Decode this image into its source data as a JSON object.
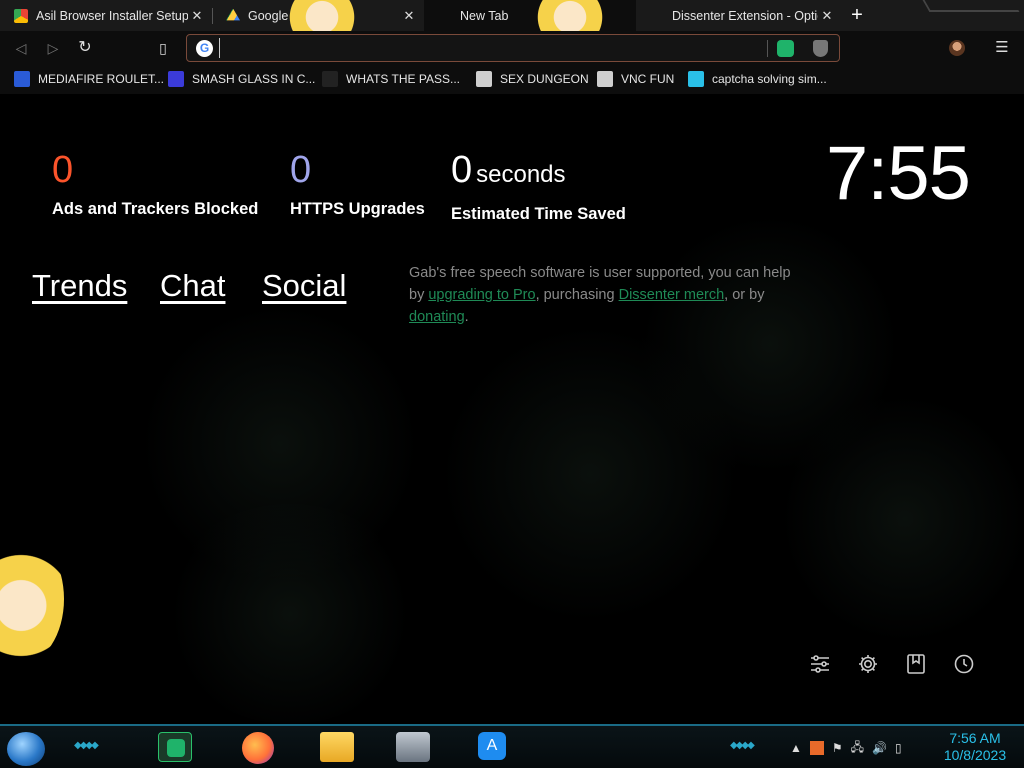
{
  "tabs": [
    {
      "title": "Asil Browser Installer Setup.exe",
      "favicon": "chrome-webstore-icon",
      "active": false
    },
    {
      "title": "Google Drive",
      "favicon": "google-drive-icon",
      "active": false
    },
    {
      "title": "New Tab",
      "favicon": "",
      "active": true
    },
    {
      "title": "Dissenter Extension - Options",
      "favicon": "",
      "active": false
    }
  ],
  "toolbar": {
    "address_value": "",
    "icons": {
      "back": "back-icon",
      "forward": "forward-icon",
      "reload": "reload-icon",
      "bookmark": "bookmark-icon",
      "menu": "menu-icon"
    }
  },
  "bookmarks": [
    {
      "label": "MEDIAFIRE ROULET...",
      "color": "#2a5bd7"
    },
    {
      "label": "SMASH GLASS IN C...",
      "color": "#3b3bd9"
    },
    {
      "label": "WHATS THE PASS...",
      "color": "#222222"
    },
    {
      "label": "SEX DUNGEON",
      "color": "#cfcfcf"
    },
    {
      "label": "VNC FUN",
      "color": "#cfcfcf"
    },
    {
      "label": "captcha solving sim...",
      "color": "#2ac0e8"
    }
  ],
  "stats": {
    "ads": {
      "value": "0",
      "label": "Ads and Trackers Blocked",
      "color": "#fb542b"
    },
    "https": {
      "value": "0",
      "label": "HTTPS Upgrades",
      "color": "#a0a5eb"
    },
    "time": {
      "value": "0",
      "unit": "seconds",
      "label": "Estimated Time Saved"
    }
  },
  "clock": "7:55",
  "links": {
    "trends": "Trends",
    "chat": "Chat",
    "social": "Social"
  },
  "promo": {
    "text1": "Gab's free speech software is user supported, you can help by ",
    "link1": "upgrading to Pro",
    "text2": ", purchasing ",
    "link2": "Dissenter merch",
    "text3": ", or by ",
    "link3": "donating",
    "text4": ".",
    "link_color": "#1f8a56"
  },
  "taskbar": {
    "time": "7:56 AM",
    "date": "10/8/2023",
    "apps": [
      "dissenter-browser-icon",
      "firefox-icon",
      "file-explorer-icon",
      "network-tool-icon",
      "app-store-icon"
    ]
  }
}
